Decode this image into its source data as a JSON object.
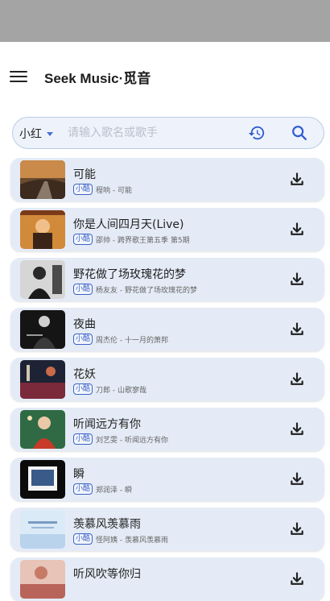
{
  "app": {
    "title": "Seek Music·觅音"
  },
  "search": {
    "source": "小红",
    "placeholder": "请输入歌名或歌手",
    "value": ""
  },
  "songs": [
    {
      "title": "可能",
      "badge": "小酷",
      "meta": "程响 - 可能"
    },
    {
      "title": "你是人间四月天(Live)",
      "badge": "小酷",
      "meta": "邵帅 - 跨界歌王第五季 第5期"
    },
    {
      "title": "野花做了场玫瑰花的梦",
      "badge": "小酷",
      "meta": "杨友友 - 野花做了场玫瑰花的梦"
    },
    {
      "title": "夜曲",
      "badge": "小酷",
      "meta": "周杰伦 - 十一月的萧邦"
    },
    {
      "title": "花妖",
      "badge": "小酷",
      "meta": "刀郎 - 山歌寥哉"
    },
    {
      "title": "听闻远方有你",
      "badge": "小酷",
      "meta": "刘艺雯 - 听闻远方有你"
    },
    {
      "title": "瞬",
      "badge": "小酷",
      "meta": "郑润泽 - 瞬"
    },
    {
      "title": "羡慕风羡慕雨",
      "badge": "小酷",
      "meta": "怪阿姨 - 羡慕风羡慕雨"
    },
    {
      "title": "听风吹等你归",
      "badge": "",
      "meta": ""
    }
  ],
  "colors": {
    "accent": "#3a62c9",
    "card": "#e4ebf6",
    "statusbar": "#a4a4a4"
  }
}
